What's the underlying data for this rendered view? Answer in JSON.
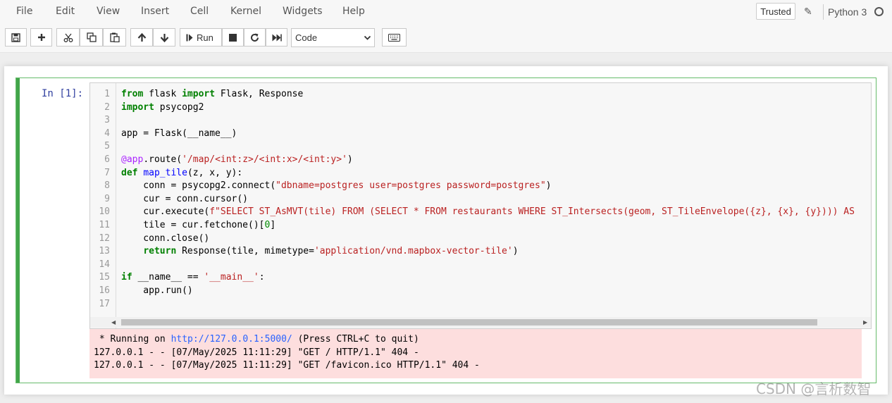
{
  "menubar": {
    "items": [
      "File",
      "Edit",
      "View",
      "Insert",
      "Cell",
      "Kernel",
      "Widgets",
      "Help"
    ],
    "trusted_label": "Trusted",
    "kernel_name": "Python 3"
  },
  "toolbar": {
    "run_label": "Run",
    "cell_type": "Code"
  },
  "cell": {
    "prompt": "In  [1]:",
    "line_numbers": [
      "1",
      "2",
      "3",
      "4",
      "5",
      "6",
      "7",
      "8",
      "9",
      "10",
      "11",
      "12",
      "13",
      "14",
      "15",
      "16",
      "17"
    ]
  },
  "code": {
    "l1_a": "from",
    "l1_b": " flask ",
    "l1_c": "import",
    "l1_d": " Flask, Response",
    "l2_a": "import",
    "l2_b": " psycopg2",
    "l4": "app = Flask(__name__)",
    "l6_a": "@app",
    "l6_b": ".route(",
    "l6_c": "'/map/<int:z>/<int:x>/<int:y>'",
    "l6_d": ")",
    "l7_a": "def",
    "l7_b": " ",
    "l7_c": "map_tile",
    "l7_d": "(z, x, y):",
    "l8_a": "    conn = psycopg2.connect(",
    "l8_b": "\"dbname=postgres user=postgres password=postgres\"",
    "l8_c": ")",
    "l9": "    cur = conn.cursor()",
    "l10_a": "    cur.execute(",
    "l10_b": "f\"SELECT ST_AsMVT(tile) FROM (SELECT * FROM restaurants WHERE ST_Intersects(geom, ST_TileEnvelope({z}, {x}, {y}))) AS",
    "l11_a": "    tile = cur.fetchone()[",
    "l11_b": "0",
    "l11_c": "]",
    "l12": "    conn.close()",
    "l13_a": "    ",
    "l13_b": "return",
    "l13_c": " Response(tile, mimetype=",
    "l13_d": "'application/vnd.mapbox-vector-tile'",
    "l13_e": ")",
    "l15_a": "if",
    "l15_b": " __name__ == ",
    "l15_c": "'__main__'",
    "l15_d": ":",
    "l16": "    app.run()"
  },
  "output": {
    "line1_a": " * Running on ",
    "line1_link": "http://127.0.0.1:5000/",
    "line1_b": " (Press CTRL+C to quit)",
    "line2": "127.0.0.1 - - [07/May/2025 11:11:29] \"GET / HTTP/1.1\" 404 -",
    "line3": "127.0.0.1 - - [07/May/2025 11:11:29] \"GET /favicon.ico HTTP/1.1\" 404 -"
  },
  "watermark": "CSDN @言析数智",
  "colors": {
    "cell_border": "#42a54a",
    "output_bg": "#fddede",
    "keyword": "#008000",
    "string": "#ba2121"
  }
}
